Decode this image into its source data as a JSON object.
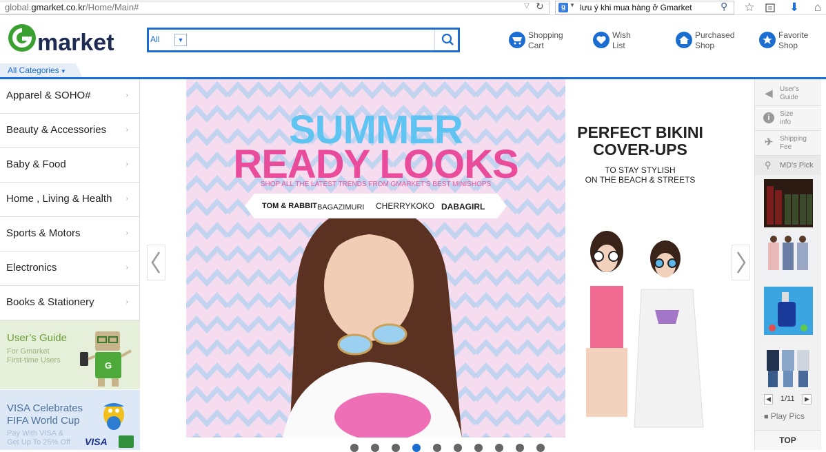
{
  "browser": {
    "url_domain_prefix": "global.",
    "url_domain": "gmarket.co.kr",
    "url_path": "/Home/Main#",
    "search_query": "lưu ý khi mua hàng ở Gmarket",
    "search_engine_icon": "google-icon",
    "toolbar_icons": [
      "bookmark-star-icon",
      "reading-list-icon",
      "download-icon",
      "home-icon"
    ]
  },
  "header": {
    "logo_text": "Gmarket",
    "search": {
      "category": "All",
      "placeholder": ""
    },
    "buttons": [
      {
        "label": "Shopping\nCart",
        "icon": "cart-icon"
      },
      {
        "label": "Wish\nList",
        "icon": "heart-icon"
      },
      {
        "label": "Purchased\nShop",
        "icon": "house-icon"
      },
      {
        "label": "Favorite\nShop",
        "icon": "star-icon"
      }
    ],
    "all_categories": "All Categories"
  },
  "categories": [
    "Apparel & SOHO#",
    "Beauty & Accessories",
    "Baby & Food",
    "Home , Living & Health",
    "Sports & Motors",
    "Electronics",
    "Books & Stationery"
  ],
  "promos": {
    "guide": {
      "title": "User’s Guide",
      "sub": "For Gmarket\nFirst-time Users"
    },
    "visa": {
      "title": "VISA Celebrates\nFIFA World Cup",
      "sub": "Pay With VISA &\nGet Up To 25% Off",
      "logo": "VISA"
    }
  },
  "banner": {
    "line1": "SUMMER",
    "line2": "READY LOOKS",
    "tagline": "SHOP ALL THE LATEST TRENDS FROM GMARKET'S BEST MINISHOPS",
    "brands": [
      "TOM & RABBIT",
      "BAGAZIMURI",
      "CHERRYKOKO",
      "DABAGIRL"
    ],
    "right_title": "PERFECT BIKINI COVER-UPS",
    "right_title_l1": "PERFECT BIKINI",
    "right_title_l2": "COVER-UPS",
    "right_sub_l1": "TO STAY STYLISH",
    "right_sub_l2": "ON THE BEACH & STREETS",
    "dots_count": 10,
    "active_dot": 4
  },
  "rail": {
    "items": [
      {
        "label": "User's\nGuide",
        "icon": "speaker-icon"
      },
      {
        "label": "Size\ninfo",
        "icon": "info-icon"
      },
      {
        "label": "Shipping\nFee",
        "icon": "airplane-icon"
      }
    ],
    "md_pick": "MD's Pick",
    "pager": "1/11",
    "play_pics": "Play Pics",
    "top": "TOP"
  },
  "colors": {
    "brand_blue": "#1b6dd1",
    "logo_green": "#3aa030",
    "logo_navy": "#1d2b55"
  }
}
